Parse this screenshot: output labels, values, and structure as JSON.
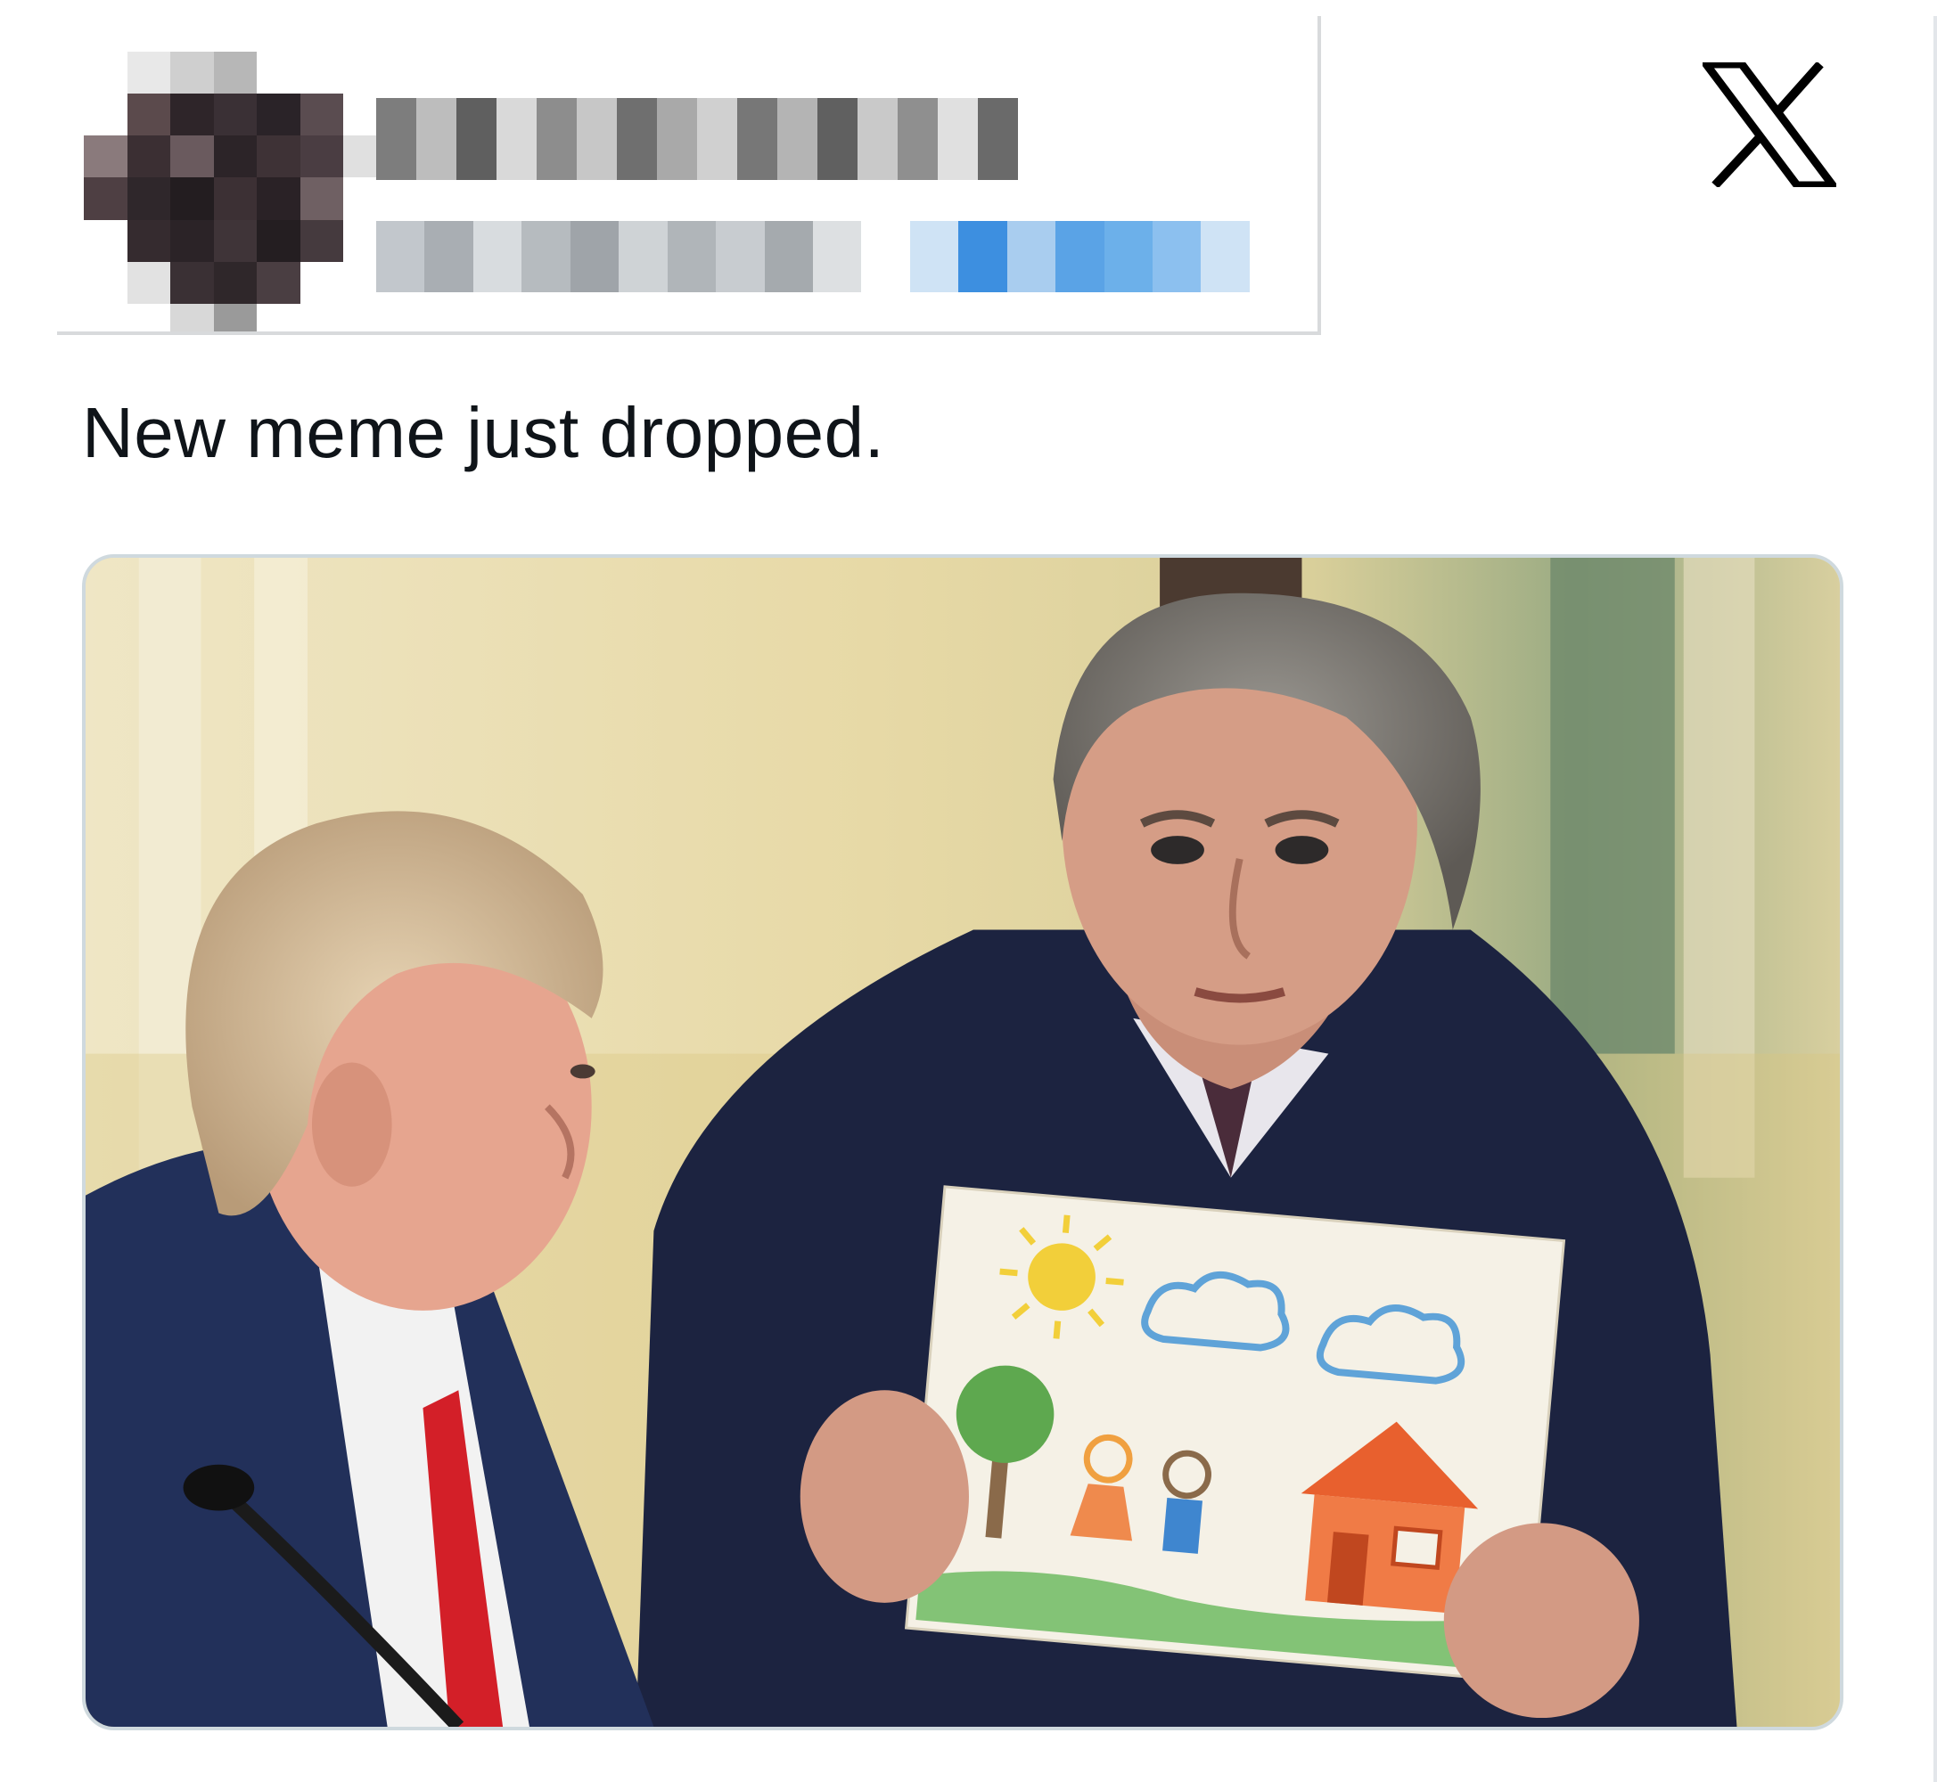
{
  "tweet": {
    "text": "New meme just dropped.",
    "author_redacted": true
  },
  "icons": {
    "platform": "x-logo-icon"
  },
  "media": {
    "type": "photo"
  },
  "colors": {
    "text": "#0f1419",
    "border": "#cfd9de",
    "handle_link": "#5aa3e6"
  }
}
